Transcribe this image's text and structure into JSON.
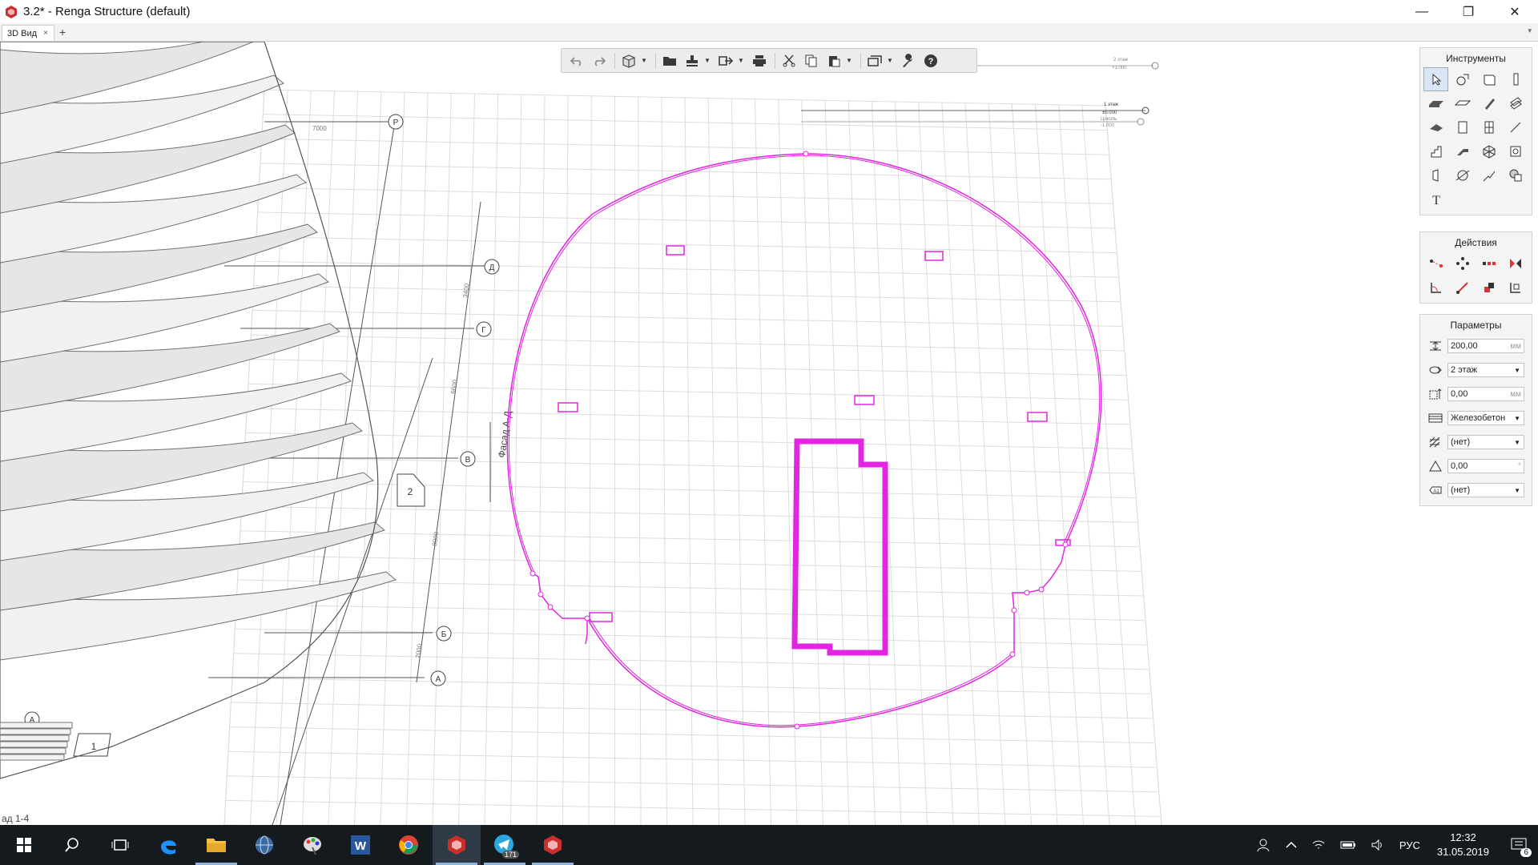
{
  "window": {
    "title": "3.2* - Renga Structure (default)"
  },
  "tabs": {
    "active": "3D Вид",
    "close": "×",
    "add": "+",
    "dropdown": "▾"
  },
  "window_controls": {
    "minimize": "—",
    "maximize": "❐",
    "close": "✕"
  },
  "panels": {
    "tools_title": "Инструменты",
    "actions_title": "Действия",
    "params_title": "Параметры"
  },
  "params": {
    "thickness": "200,00",
    "thickness_unit": "мм",
    "level": "2 этаж",
    "offset": "0,00",
    "offset_unit": "мм",
    "material": "Железобетон",
    "hatch": "(нет)",
    "angle": "0,00",
    "angle_unit": "°",
    "mark": "(нет)"
  },
  "drawing": {
    "axis_labels": [
      "Р",
      "Д",
      "Г",
      "В",
      "Б",
      "А",
      "А"
    ],
    "dims": [
      "7000",
      "3400",
      "6600",
      "8000",
      "2000"
    ],
    "facade_label": "Фасад А-Д",
    "section_labels": [
      "2",
      "1"
    ],
    "bottom_text": "ад 1-4",
    "level_markers": [
      {
        "name": "2 этаж",
        "value": "+3.000"
      },
      {
        "name": "1 этаж",
        "value": "±0.000"
      },
      {
        "name": "Цоколь",
        "value": "-1.000"
      }
    ]
  },
  "taskbar": {
    "telegram_badge": "171",
    "notif_count": "6",
    "lang": "РУС",
    "time": "12:32",
    "date": "31.05.2019"
  }
}
